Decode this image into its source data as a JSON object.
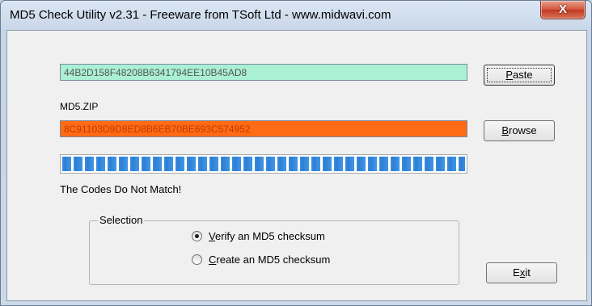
{
  "window": {
    "title": "MD5 Check Utility v2.31 - Freeware from TSoft Ltd - www.midwavi.com",
    "close_glyph": "X"
  },
  "checksum_input": {
    "value": "44B2D158F48208B6341794EE10B45AD8",
    "background_color": "#aaf0d4"
  },
  "file": {
    "name": "MD5.ZIP",
    "computed_value": "8C91103D9D8ED8B6EB70BE693C574952",
    "background_color": "#ff6a14"
  },
  "buttons": {
    "paste_label_accel": "P",
    "paste_label_rest": "aste",
    "browse_label_accel": "B",
    "browse_label_rest": "rowse",
    "exit_label_pre": "E",
    "exit_label_accel": "x",
    "exit_label_rest": "it"
  },
  "progress": {
    "fraction": 1.0,
    "color": "#3d8fe0"
  },
  "status_text": "The Codes Do Not Match!",
  "selection": {
    "legend": "Selection",
    "options": [
      {
        "accel": "V",
        "rest": "erify an MD5 checksum",
        "selected": true
      },
      {
        "accel": "C",
        "rest": "reate an MD5 checksum",
        "selected": false
      }
    ]
  }
}
